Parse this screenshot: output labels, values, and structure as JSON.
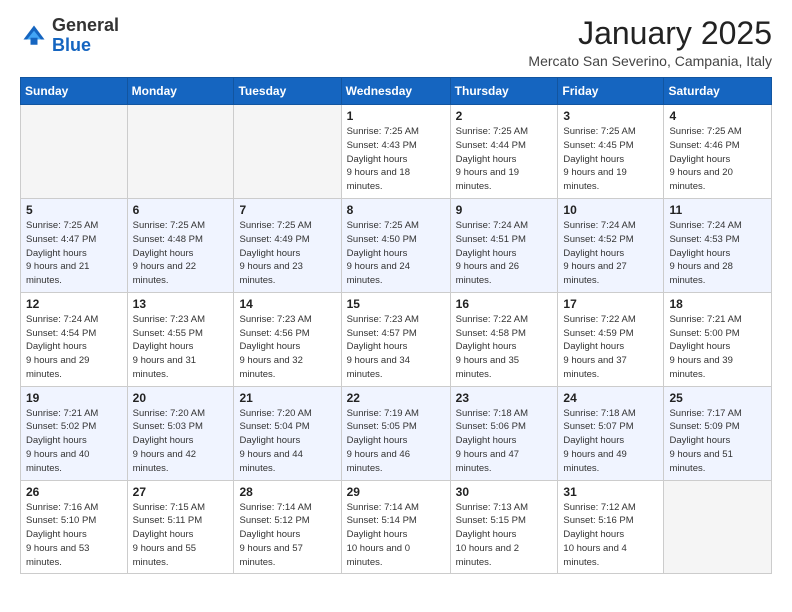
{
  "header": {
    "logo_general": "General",
    "logo_blue": "Blue",
    "month_title": "January 2025",
    "location": "Mercato San Severino, Campania, Italy"
  },
  "weekdays": [
    "Sunday",
    "Monday",
    "Tuesday",
    "Wednesday",
    "Thursday",
    "Friday",
    "Saturday"
  ],
  "weeks": [
    [
      {
        "day": "",
        "empty": true
      },
      {
        "day": "",
        "empty": true
      },
      {
        "day": "",
        "empty": true
      },
      {
        "day": "1",
        "sunrise": "7:25 AM",
        "sunset": "4:43 PM",
        "daylight": "9 hours and 18 minutes."
      },
      {
        "day": "2",
        "sunrise": "7:25 AM",
        "sunset": "4:44 PM",
        "daylight": "9 hours and 19 minutes."
      },
      {
        "day": "3",
        "sunrise": "7:25 AM",
        "sunset": "4:45 PM",
        "daylight": "9 hours and 19 minutes."
      },
      {
        "day": "4",
        "sunrise": "7:25 AM",
        "sunset": "4:46 PM",
        "daylight": "9 hours and 20 minutes."
      }
    ],
    [
      {
        "day": "5",
        "sunrise": "7:25 AM",
        "sunset": "4:47 PM",
        "daylight": "9 hours and 21 minutes."
      },
      {
        "day": "6",
        "sunrise": "7:25 AM",
        "sunset": "4:48 PM",
        "daylight": "9 hours and 22 minutes."
      },
      {
        "day": "7",
        "sunrise": "7:25 AM",
        "sunset": "4:49 PM",
        "daylight": "9 hours and 23 minutes."
      },
      {
        "day": "8",
        "sunrise": "7:25 AM",
        "sunset": "4:50 PM",
        "daylight": "9 hours and 24 minutes."
      },
      {
        "day": "9",
        "sunrise": "7:24 AM",
        "sunset": "4:51 PM",
        "daylight": "9 hours and 26 minutes."
      },
      {
        "day": "10",
        "sunrise": "7:24 AM",
        "sunset": "4:52 PM",
        "daylight": "9 hours and 27 minutes."
      },
      {
        "day": "11",
        "sunrise": "7:24 AM",
        "sunset": "4:53 PM",
        "daylight": "9 hours and 28 minutes."
      }
    ],
    [
      {
        "day": "12",
        "sunrise": "7:24 AM",
        "sunset": "4:54 PM",
        "daylight": "9 hours and 29 minutes."
      },
      {
        "day": "13",
        "sunrise": "7:23 AM",
        "sunset": "4:55 PM",
        "daylight": "9 hours and 31 minutes."
      },
      {
        "day": "14",
        "sunrise": "7:23 AM",
        "sunset": "4:56 PM",
        "daylight": "9 hours and 32 minutes."
      },
      {
        "day": "15",
        "sunrise": "7:23 AM",
        "sunset": "4:57 PM",
        "daylight": "9 hours and 34 minutes."
      },
      {
        "day": "16",
        "sunrise": "7:22 AM",
        "sunset": "4:58 PM",
        "daylight": "9 hours and 35 minutes."
      },
      {
        "day": "17",
        "sunrise": "7:22 AM",
        "sunset": "4:59 PM",
        "daylight": "9 hours and 37 minutes."
      },
      {
        "day": "18",
        "sunrise": "7:21 AM",
        "sunset": "5:00 PM",
        "daylight": "9 hours and 39 minutes."
      }
    ],
    [
      {
        "day": "19",
        "sunrise": "7:21 AM",
        "sunset": "5:02 PM",
        "daylight": "9 hours and 40 minutes."
      },
      {
        "day": "20",
        "sunrise": "7:20 AM",
        "sunset": "5:03 PM",
        "daylight": "9 hours and 42 minutes."
      },
      {
        "day": "21",
        "sunrise": "7:20 AM",
        "sunset": "5:04 PM",
        "daylight": "9 hours and 44 minutes."
      },
      {
        "day": "22",
        "sunrise": "7:19 AM",
        "sunset": "5:05 PM",
        "daylight": "9 hours and 46 minutes."
      },
      {
        "day": "23",
        "sunrise": "7:18 AM",
        "sunset": "5:06 PM",
        "daylight": "9 hours and 47 minutes."
      },
      {
        "day": "24",
        "sunrise": "7:18 AM",
        "sunset": "5:07 PM",
        "daylight": "9 hours and 49 minutes."
      },
      {
        "day": "25",
        "sunrise": "7:17 AM",
        "sunset": "5:09 PM",
        "daylight": "9 hours and 51 minutes."
      }
    ],
    [
      {
        "day": "26",
        "sunrise": "7:16 AM",
        "sunset": "5:10 PM",
        "daylight": "9 hours and 53 minutes."
      },
      {
        "day": "27",
        "sunrise": "7:15 AM",
        "sunset": "5:11 PM",
        "daylight": "9 hours and 55 minutes."
      },
      {
        "day": "28",
        "sunrise": "7:14 AM",
        "sunset": "5:12 PM",
        "daylight": "9 hours and 57 minutes."
      },
      {
        "day": "29",
        "sunrise": "7:14 AM",
        "sunset": "5:14 PM",
        "daylight": "10 hours and 0 minutes."
      },
      {
        "day": "30",
        "sunrise": "7:13 AM",
        "sunset": "5:15 PM",
        "daylight": "10 hours and 2 minutes."
      },
      {
        "day": "31",
        "sunrise": "7:12 AM",
        "sunset": "5:16 PM",
        "daylight": "10 hours and 4 minutes."
      },
      {
        "day": "",
        "empty": true
      }
    ]
  ]
}
